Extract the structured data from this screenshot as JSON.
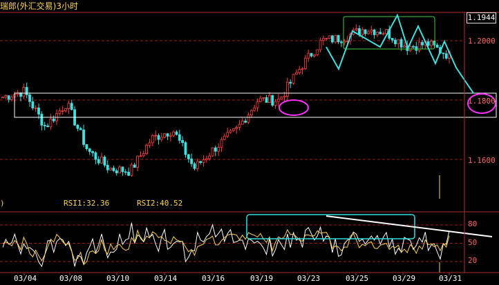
{
  "window": {
    "title": "瑞郎(外汇交易)3小时",
    "current_price": "1.1944"
  },
  "colors": {
    "up": "#ff4040",
    "down": "#40e0e0",
    "grid": "#a02020",
    "rsi1": "#ffffff",
    "rsi2": "#ffd34d",
    "zone_box": "#ffffff",
    "magenta": "#ff33ff",
    "green_box": "#44cc44",
    "cyan_box": "#33dddd"
  },
  "rsi": {
    "paren": ")",
    "rsi1_label": "RSI1:32.36",
    "rsi2_label": "RSI2:40.52"
  },
  "price_axis": {
    "ticks": [
      "1.2000",
      "1.1800",
      "1.1600"
    ]
  },
  "rsi_axis": {
    "ticks": [
      "80",
      "50",
      "20"
    ]
  },
  "dates": [
    "03/04",
    "03/08",
    "03/10",
    "03/14",
    "03/16",
    "03/19",
    "03/23",
    "03/25",
    "03/29",
    "03/31"
  ],
  "chart_data": {
    "type": "candlestick",
    "instrument": "瑞郎(外汇交易)",
    "interval": "3小时",
    "x_labels": [
      "03/04",
      "03/08",
      "03/10",
      "03/14",
      "03/16",
      "03/19",
      "03/23",
      "03/25",
      "03/29",
      "03/31"
    ],
    "y_ticks": [
      1.2,
      1.18,
      1.16
    ],
    "last_price": 1.1944,
    "close_path_anchors": [
      {
        "date": "03/04",
        "close": 1.181
      },
      {
        "date": "03/04",
        "close": 1.183
      },
      {
        "date": "03/08",
        "close": 1.171
      },
      {
        "date": "03/08",
        "close": 1.179
      },
      {
        "date": "03/10",
        "close": 1.163
      },
      {
        "date": "03/10",
        "close": 1.157
      },
      {
        "date": "03/14",
        "close": 1.156
      },
      {
        "date": "03/14",
        "close": 1.167
      },
      {
        "date": "03/16",
        "close": 1.17
      },
      {
        "date": "03/16",
        "close": 1.157
      },
      {
        "date": "03/19",
        "close": 1.164
      },
      {
        "date": "03/19",
        "close": 1.17
      },
      {
        "date": "03/19",
        "close": 1.18
      },
      {
        "date": "03/23",
        "close": 1.18
      },
      {
        "date": "03/23",
        "close": 1.191
      },
      {
        "date": "03/23",
        "close": 1.2
      },
      {
        "date": "03/25",
        "close": 1.201
      },
      {
        "date": "03/25",
        "close": 1.204
      },
      {
        "date": "03/29",
        "close": 1.203
      },
      {
        "date": "03/29",
        "close": 1.198
      },
      {
        "date": "03/31",
        "close": 1.199
      },
      {
        "date": "03/31",
        "close": 1.195
      }
    ],
    "rsi": {
      "rsi1": 32.36,
      "rsi2": 40.52,
      "levels": [
        80,
        50,
        20
      ]
    },
    "annotations": [
      "white horizontal box around 1.176–1.183",
      "magenta ellipse around consolidation near 03/21",
      "green box around top consolidation 03/24–03/29",
      "cyan projection line toward 1.180",
      "magenta ellipse around 1.1800 on axis",
      "cyan box on RSI 03/19–03/30",
      "white descending trend line on RSI"
    ]
  }
}
